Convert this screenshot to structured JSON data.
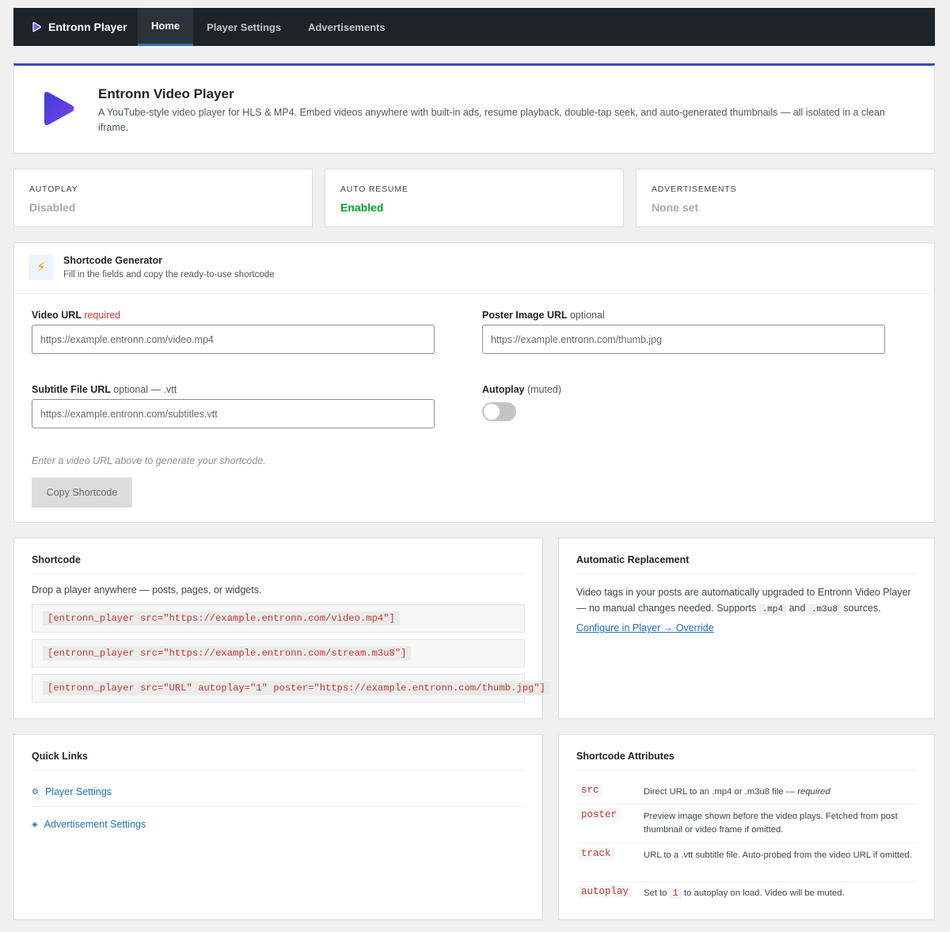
{
  "nav": {
    "brand": "Entronn Player",
    "tabs": [
      "Home",
      "Player Settings",
      "Advertisements"
    ]
  },
  "hero": {
    "title": "Entronn Video Player",
    "description": "A YouTube-style video player for HLS & MP4. Embed videos anywhere with built-in ads, resume playback, double-tap seek, and auto-generated thumbnails — all isolated in a clean iframe."
  },
  "stats": [
    {
      "label": "AUTOPLAY",
      "value": "Disabled",
      "color": "#a7aaad"
    },
    {
      "label": "AUTO RESUME",
      "value": "Enabled",
      "color": "#00a32a"
    },
    {
      "label": "ADVERTISEMENTS",
      "value": "None set",
      "color": "#a7aaad"
    }
  ],
  "generator": {
    "title": "Shortcode Generator",
    "subtitle": "Fill in the fields and copy the ready-to-use shortcode",
    "video_url": {
      "label": "Video URL",
      "note": "required",
      "placeholder": "https://example.entronn.com/video.mp4"
    },
    "poster_url": {
      "label": "Poster Image URL",
      "note": "optional",
      "placeholder": "https://example.entronn.com/thumb.jpg"
    },
    "subtitle_url": {
      "label": "Subtitle File URL",
      "note": "optional — .vtt",
      "placeholder": "https://example.entronn.com/subtitles.vtt"
    },
    "autoplay": {
      "label": "Autoplay",
      "note": "(muted)",
      "on": false
    },
    "hint": "Enter a video URL above to generate your shortcode.",
    "copy_label": "Copy Shortcode"
  },
  "shortcode": {
    "title": "Shortcode",
    "description": "Drop a player anywhere — posts, pages, or widgets.",
    "examples": [
      "[entronn_player src=\"https://example.entronn.com/video.mp4\"]",
      "[entronn_player src=\"https://example.entronn.com/stream.m3u8\"]",
      "[entronn_player src=\"URL\" autoplay=\"1\" poster=\"https://example.entronn.com/thumb.jpg\"]"
    ]
  },
  "replacement": {
    "title": "Automatic Replacement",
    "text_before": "Video tags in your posts are automatically upgraded to Entronn Video Player — no manual changes needed. Supports ",
    "ext1": ".mp4",
    "text_mid": " and ",
    "ext2": ".m3u8",
    "text_after": " sources.",
    "link": "Configure in Player → Override"
  },
  "quick_links": {
    "title": "Quick Links",
    "items": [
      {
        "label": "Player Settings",
        "icon": "gear-icon"
      },
      {
        "label": "Advertisement Settings",
        "icon": "diamond-icon"
      }
    ]
  },
  "attributes": {
    "title": "Shortcode Attributes",
    "rows": [
      {
        "name": "src",
        "desc_before": "Direct URL to an .mp4 or .m3u8 file — ",
        "desc_em": "required"
      },
      {
        "name": "poster",
        "desc": "Preview image shown before the video plays. Fetched from post thumbnail or video frame if omitted."
      },
      {
        "name": "track",
        "desc": "URL to a .vtt subtitle file. Auto-probed from the video URL if omitted."
      },
      {
        "name": "autoplay",
        "desc_before": "Set to ",
        "desc_code": "1",
        "desc_after": " to autoplay on load. Video will be muted."
      }
    ]
  }
}
